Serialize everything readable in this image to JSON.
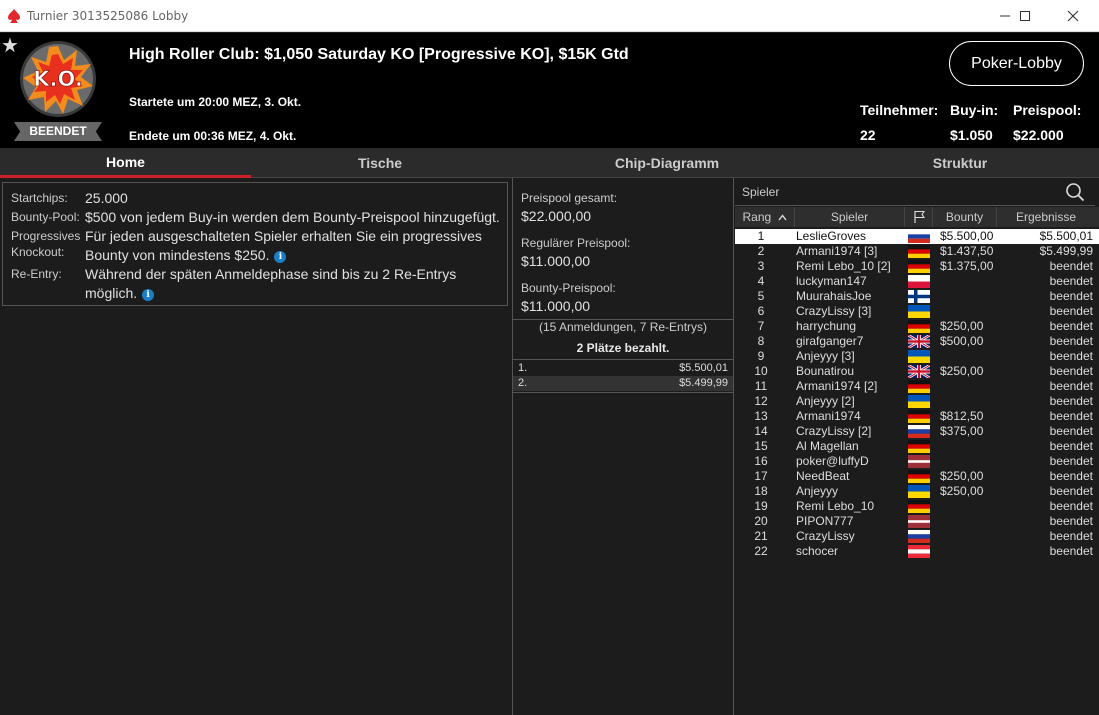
{
  "window": {
    "title": "Turnier 3013525086 Lobby",
    "minimize": "—",
    "maximize": "☐",
    "close": "✕"
  },
  "header": {
    "logo_text": "K.O.",
    "status": "BEENDET",
    "title": "High Roller Club: $1,050 Saturday KO [Progressive KO], $15K Gtd",
    "started": "Startete um 20:00 MEZ, 3. Okt.",
    "ended": "Endete um 00:36 MEZ, 4. Okt.",
    "lobby_button": "Poker-Lobby",
    "stats": [
      {
        "label": "Teilnehmer:",
        "value": "22"
      },
      {
        "label": "Buy-in:",
        "value": "$1.050"
      },
      {
        "label": "Preispool:",
        "value": "$22.000"
      }
    ]
  },
  "tabs": [
    "Home",
    "Tische",
    "Chip-Diagramm",
    "Struktur"
  ],
  "info": {
    "startchips_label": "Startchips:",
    "startchips_value": "25.000",
    "bountypool_label": "Bounty-Pool:",
    "bountypool_value": "$500 von jedem Buy-in werden dem Bounty-Preispool hinzugefügt.",
    "pko_label_1": "Progressives",
    "pko_label_2": "Knockout:",
    "pko_value_1": "Für jeden ausgeschalteten Spieler erhalten Sie ein progressives",
    "pko_value_2": "Bounty von mindestens $250.",
    "reentry_label": "Re-Entry:",
    "reentry_value_1": "Während der späten Anmeldephase sind bis zu 2 Re-Entrys",
    "reentry_value_2": "möglich."
  },
  "prize": {
    "total_label": "Preispool gesamt:",
    "total_value": "$22.000,00",
    "regular_label": "Regulärer Preispool:",
    "regular_value": "$11.000,00",
    "bounty_label": "Bounty-Preispool:",
    "bounty_value": "$11.000,00",
    "registrations": "(15 Anmeldungen, 7 Re-Entrys)",
    "paid": "2 Plätze bezahlt.",
    "payouts": [
      {
        "pos": "1.",
        "amount": "$5.500,01"
      },
      {
        "pos": "2.",
        "amount": "$5.499,99"
      }
    ]
  },
  "players": {
    "search_placeholder": "Spieler",
    "columns": {
      "rank": "Rang",
      "player": "Spieler",
      "bounty": "Bounty",
      "results": "Ergebnisse"
    },
    "rows": [
      {
        "rank": "1",
        "name": "LeslieGroves",
        "flag": "ru",
        "bounty": "$5.500,00",
        "result": "$5.500,01"
      },
      {
        "rank": "2",
        "name": "Armani1974 [3]",
        "flag": "de",
        "bounty": "$1.437,50",
        "result": "$5.499,99"
      },
      {
        "rank": "3",
        "name": "Remi Lebo_10 [2]",
        "flag": "de",
        "bounty": "$1.375,00",
        "result": "beendet"
      },
      {
        "rank": "4",
        "name": "luckyman147",
        "flag": "pl",
        "bounty": "",
        "result": "beendet"
      },
      {
        "rank": "5",
        "name": "MuurahaisJoe",
        "flag": "fi",
        "bounty": "",
        "result": "beendet"
      },
      {
        "rank": "6",
        "name": "CrazyLissy [3]",
        "flag": "ua",
        "bounty": "",
        "result": "beendet"
      },
      {
        "rank": "7",
        "name": "harrychung",
        "flag": "de",
        "bounty": "$250,00",
        "result": "beendet"
      },
      {
        "rank": "8",
        "name": "girafganger7",
        "flag": "gb",
        "bounty": "$500,00",
        "result": "beendet"
      },
      {
        "rank": "9",
        "name": "Anjeyyy [3]",
        "flag": "ua",
        "bounty": "",
        "result": "beendet"
      },
      {
        "rank": "10",
        "name": "Bounatirou",
        "flag": "gb",
        "bounty": "$250,00",
        "result": "beendet"
      },
      {
        "rank": "11",
        "name": "Armani1974 [2]",
        "flag": "de",
        "bounty": "",
        "result": "beendet"
      },
      {
        "rank": "12",
        "name": "Anjeyyy [2]",
        "flag": "ua",
        "bounty": "",
        "result": "beendet"
      },
      {
        "rank": "13",
        "name": "Armani1974",
        "flag": "de",
        "bounty": "$812,50",
        "result": "beendet"
      },
      {
        "rank": "14",
        "name": "CrazyLissy [2]",
        "flag": "ru",
        "bounty": "$375,00",
        "result": "beendet"
      },
      {
        "rank": "15",
        "name": "Al Magellan",
        "flag": "de",
        "bounty": "",
        "result": "beendet"
      },
      {
        "rank": "16",
        "name": "poker@luffyD",
        "flag": "lv",
        "bounty": "",
        "result": "beendet"
      },
      {
        "rank": "17",
        "name": "NeedBeat",
        "flag": "de",
        "bounty": "$250,00",
        "result": "beendet"
      },
      {
        "rank": "18",
        "name": "Anjeyyy",
        "flag": "ua",
        "bounty": "$250,00",
        "result": "beendet"
      },
      {
        "rank": "19",
        "name": "Remi Lebo_10",
        "flag": "de",
        "bounty": "",
        "result": "beendet"
      },
      {
        "rank": "20",
        "name": "PIPON777",
        "flag": "lv",
        "bounty": "",
        "result": "beendet"
      },
      {
        "rank": "21",
        "name": "CrazyLissy",
        "flag": "ru",
        "bounty": "",
        "result": "beendet"
      },
      {
        "rank": "22",
        "name": "schocer",
        "flag": "at",
        "bounty": "",
        "result": "beendet"
      }
    ]
  },
  "colors": {
    "accent_red": "#cc1f2a",
    "header_bg": "#000000",
    "panel_bg": "#1c1c1c",
    "info_icon": "#1a7fc7"
  }
}
